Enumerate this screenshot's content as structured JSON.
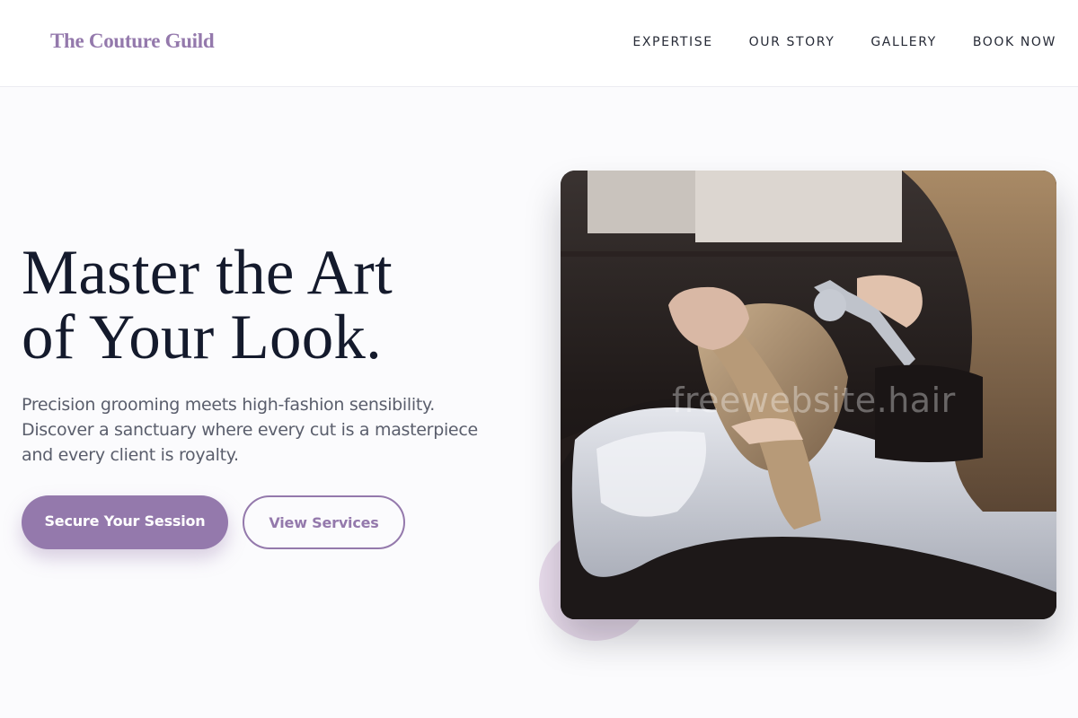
{
  "header": {
    "logo": "The Couture Guild",
    "nav": [
      "EXPERTISE",
      "OUR STORY",
      "GALLERY",
      "BOOK NOW"
    ]
  },
  "hero": {
    "title_line1": "Master the Art",
    "title_line2": "of Your Look.",
    "description": "Precision grooming meets high-fashion sensibility. Discover a sanctuary where every cut is a masterpiece and every client is royalty.",
    "primary_button": "Secure Your Session",
    "secondary_button": "View Services",
    "image_watermark": "freewebsite.hair"
  },
  "colors": {
    "brand": "#9479ac",
    "heading": "#141a2c",
    "body_text": "#5a5e6c",
    "background": "#fbfbfd",
    "accent_circle": "#e9dcec"
  }
}
